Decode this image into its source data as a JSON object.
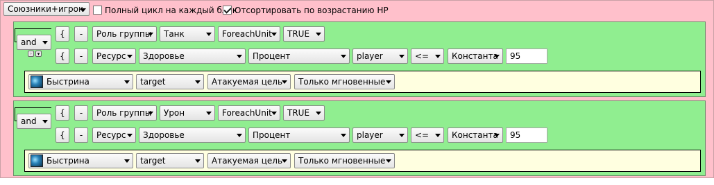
{
  "header": {
    "target_mode": "Союзники+игрок",
    "full_cycle": {
      "label": "Полный цикл на каждый блок",
      "checked": false
    },
    "sort_hp": {
      "label": "Отсортировать по возрастанию HP",
      "checked": true
    }
  },
  "blocks": [
    {
      "logic": "and",
      "conditions": [
        {
          "open": "{",
          "minus": "-",
          "field1": "Роль группы",
          "field2": "Танк",
          "field3": "ForeachUnit",
          "field4": "TRUE"
        },
        {
          "open": "{",
          "minus": "-",
          "field1": "Ресурс",
          "field2": "Здоровье",
          "field3": "Процент",
          "field4": "player",
          "op": "<=",
          "value_type": "Константа",
          "value": "95"
        }
      ],
      "action": {
        "spell": "Быстрина",
        "target": "target",
        "target_type": "Атакуемая цель",
        "cast_mode": "Только мгновенные"
      }
    },
    {
      "logic": "and",
      "conditions": [
        {
          "open": "{",
          "minus": "-",
          "field1": "Роль группы",
          "field2": "Урон",
          "field3": "ForeachUnit",
          "field4": "TRUE"
        },
        {
          "open": "{",
          "minus": "-",
          "field1": "Ресурс",
          "field2": "Здоровье",
          "field3": "Процент",
          "field4": "player",
          "op": "<=",
          "value_type": "Константа",
          "value": "95"
        }
      ],
      "action": {
        "spell": "Быстрина",
        "target": "target",
        "target_type": "Атакуемая цель",
        "cast_mode": "Только мгновенные"
      }
    }
  ],
  "icons": {
    "spell_icon": "frost-spell-icon",
    "dropdown_arrow": "chevron-down-icon"
  }
}
